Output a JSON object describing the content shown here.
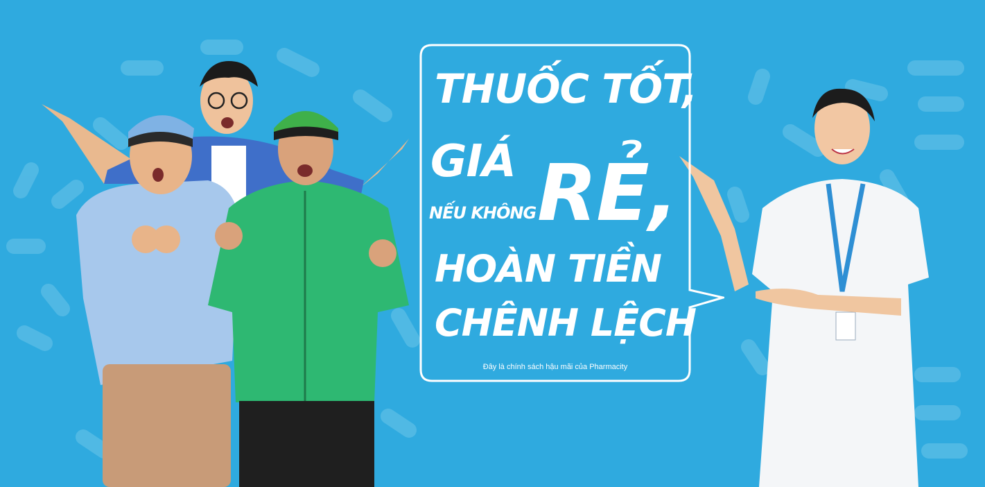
{
  "headline": {
    "line1": "THUỐC TỐT,",
    "line2": "GIÁ",
    "line3": "NẾU KHÔNG",
    "line4": "RẺ,",
    "line5": "HOÀN TIỀN",
    "line6": "CHÊNH LỆCH"
  },
  "disclaimer": "Đây là chính sách hậu mãi của Pharmacity",
  "colors": {
    "background": "#2faadf",
    "pattern": "#5cbde6",
    "bubble_border": "#ffffff",
    "green_jacket": "#2eb872",
    "lab_coat": "#f4f6f8"
  },
  "icons": {
    "pattern": "pill-pattern",
    "bubble": "speech-bubble"
  }
}
